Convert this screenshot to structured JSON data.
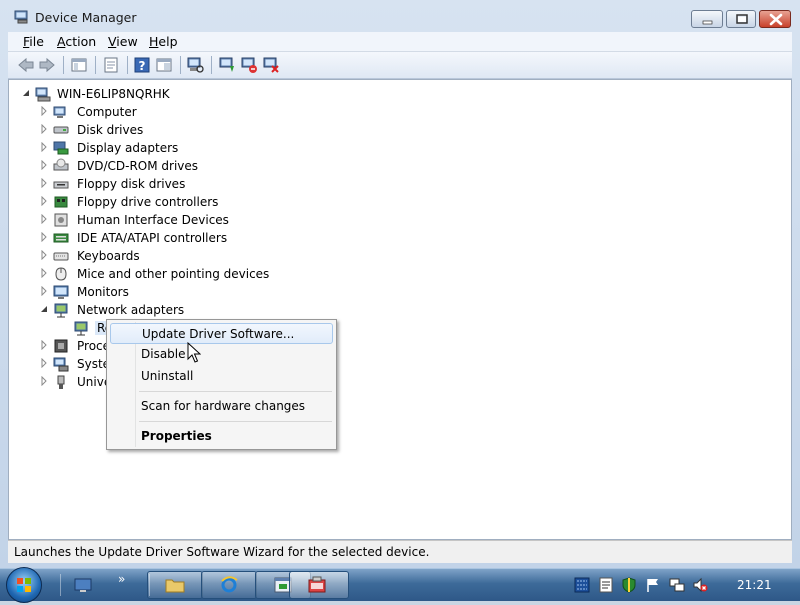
{
  "window": {
    "title": "Device Manager",
    "menu": [
      {
        "accel": "F",
        "rest": "ile"
      },
      {
        "accel": "A",
        "rest": "ction"
      },
      {
        "accel": "V",
        "rest": "iew"
      },
      {
        "accel": "H",
        "rest": "elp"
      }
    ]
  },
  "tree": {
    "root": "WIN-E6LIP8NQRHK",
    "items": [
      {
        "label": "Computer",
        "icon": "computer-icon",
        "expanded": false
      },
      {
        "label": "Disk drives",
        "icon": "disk-drive-icon",
        "expanded": false
      },
      {
        "label": "Display adapters",
        "icon": "display-adapter-icon",
        "expanded": false
      },
      {
        "label": "DVD/CD-ROM drives",
        "icon": "dvd-drive-icon",
        "expanded": false
      },
      {
        "label": "Floppy disk drives",
        "icon": "floppy-disk-icon",
        "expanded": false
      },
      {
        "label": "Floppy drive controllers",
        "icon": "floppy-controller-icon",
        "expanded": false
      },
      {
        "label": "Human Interface Devices",
        "icon": "hid-icon",
        "expanded": false
      },
      {
        "label": "IDE ATA/ATAPI controllers",
        "icon": "ide-controller-icon",
        "expanded": false
      },
      {
        "label": "Keyboards",
        "icon": "keyboard-icon",
        "expanded": false
      },
      {
        "label": "Mice and other pointing devices",
        "icon": "mouse-icon",
        "expanded": false
      },
      {
        "label": "Monitors",
        "icon": "monitor-icon",
        "expanded": false
      },
      {
        "label": "Network adapters",
        "icon": "network-adapter-icon",
        "expanded": true
      },
      {
        "label": "Re",
        "icon": "network-card-icon",
        "child": true,
        "selected": true
      },
      {
        "label": "Proce",
        "icon": "processor-icon",
        "expanded": false
      },
      {
        "label": "Syster",
        "icon": "system-device-icon",
        "expanded": false
      },
      {
        "label": "Unive",
        "icon": "usb-icon",
        "expanded": false
      }
    ]
  },
  "context_menu": {
    "items": [
      {
        "label": "Update Driver Software...",
        "accel": "P",
        "highlighted": true
      },
      {
        "label": "Disable",
        "accel": "D"
      },
      {
        "label": "Uninstall",
        "accel": "U"
      },
      {
        "label": "Scan for hardware changes",
        "accel": "a"
      },
      {
        "label": "Properties",
        "accel": "R",
        "bold": true
      }
    ]
  },
  "status": {
    "text": "Launches the Update Driver Software Wizard for the selected device."
  },
  "taskbar": {
    "clock": "21:21",
    "overflow": "»"
  }
}
